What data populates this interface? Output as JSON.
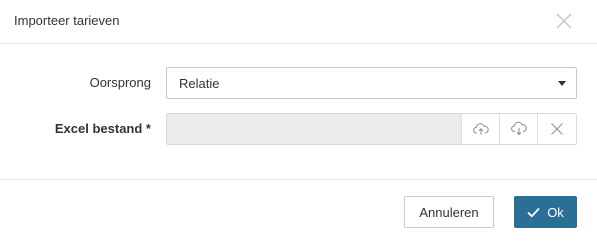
{
  "dialog": {
    "title": "Importeer tarieven",
    "close_icon": "close-icon"
  },
  "form": {
    "origin": {
      "label": "Oorsprong",
      "selected_value": "Relatie",
      "icon": "chevron-down-icon"
    },
    "excel_file": {
      "label": "Excel bestand *",
      "value": "",
      "upload_icon": "cloud-upload-icon",
      "download_icon": "cloud-download-icon",
      "clear_icon": "close-icon"
    }
  },
  "footer": {
    "cancel_label": "Annuleren",
    "ok_label": "Ok",
    "ok_icon": "checkmark-icon"
  },
  "colors": {
    "primary": "#2a6f96",
    "input_disabled_bg": "#ebebeb",
    "border": "#c8c8c8"
  }
}
